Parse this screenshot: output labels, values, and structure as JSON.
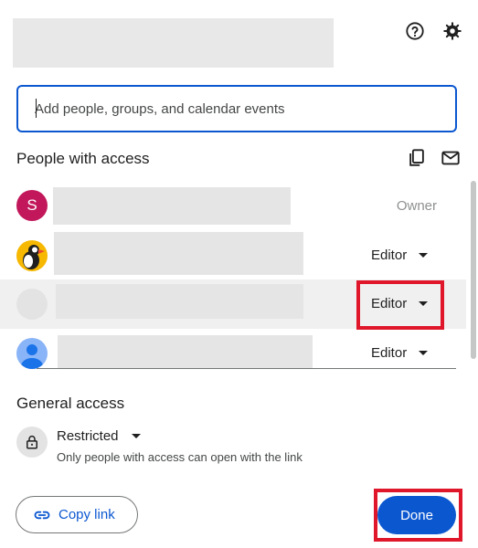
{
  "search": {
    "placeholder": "Add people, groups, and calendar events"
  },
  "people_section": {
    "title": "People with access"
  },
  "people": [
    {
      "avatar_letter": "S",
      "avatar_color": "#c2185b",
      "role": "Owner"
    },
    {
      "avatar_icon": "puffin-avatar-icon",
      "role": "Editor"
    },
    {
      "avatar_icon": "blank-avatar",
      "role": "Editor",
      "highlighted": true
    },
    {
      "avatar_icon": "default-person-avatar-icon",
      "role": "Editor"
    }
  ],
  "general_access": {
    "title": "General access",
    "setting": "Restricted",
    "description": "Only people with access can open with the link"
  },
  "footer": {
    "copy_link_label": "Copy link",
    "done_label": "Done"
  },
  "colors": {
    "accent": "#0b57d0",
    "highlight_outline": "#e0162b"
  }
}
